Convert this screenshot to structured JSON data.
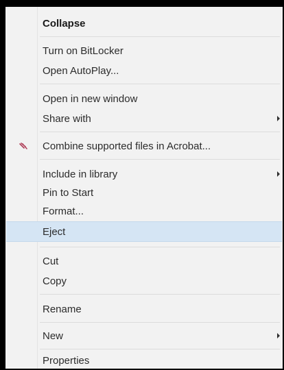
{
  "context_menu": {
    "items": [
      {
        "label": "Collapse"
      },
      {
        "label": "Turn on BitLocker"
      },
      {
        "label": "Open AutoPlay..."
      },
      {
        "label": "Open in new window"
      },
      {
        "label": "Share with"
      },
      {
        "label": "Combine supported files in Acrobat..."
      },
      {
        "label": "Include in library"
      },
      {
        "label": "Pin to Start"
      },
      {
        "label": "Format..."
      },
      {
        "label": "Eject"
      },
      {
        "label": "Cut"
      },
      {
        "label": "Copy"
      },
      {
        "label": "Rename"
      },
      {
        "label": "New"
      },
      {
        "label": "Properties"
      }
    ],
    "highlighted_item": "Eject",
    "colors": {
      "background": "#f2f2f2",
      "highlight": "#d5e5f4",
      "acrobat_icon": "#b0405a"
    },
    "icons": {
      "acrobat": "acrobat-combine-icon",
      "submenu": "submenu-arrow-icon"
    }
  }
}
